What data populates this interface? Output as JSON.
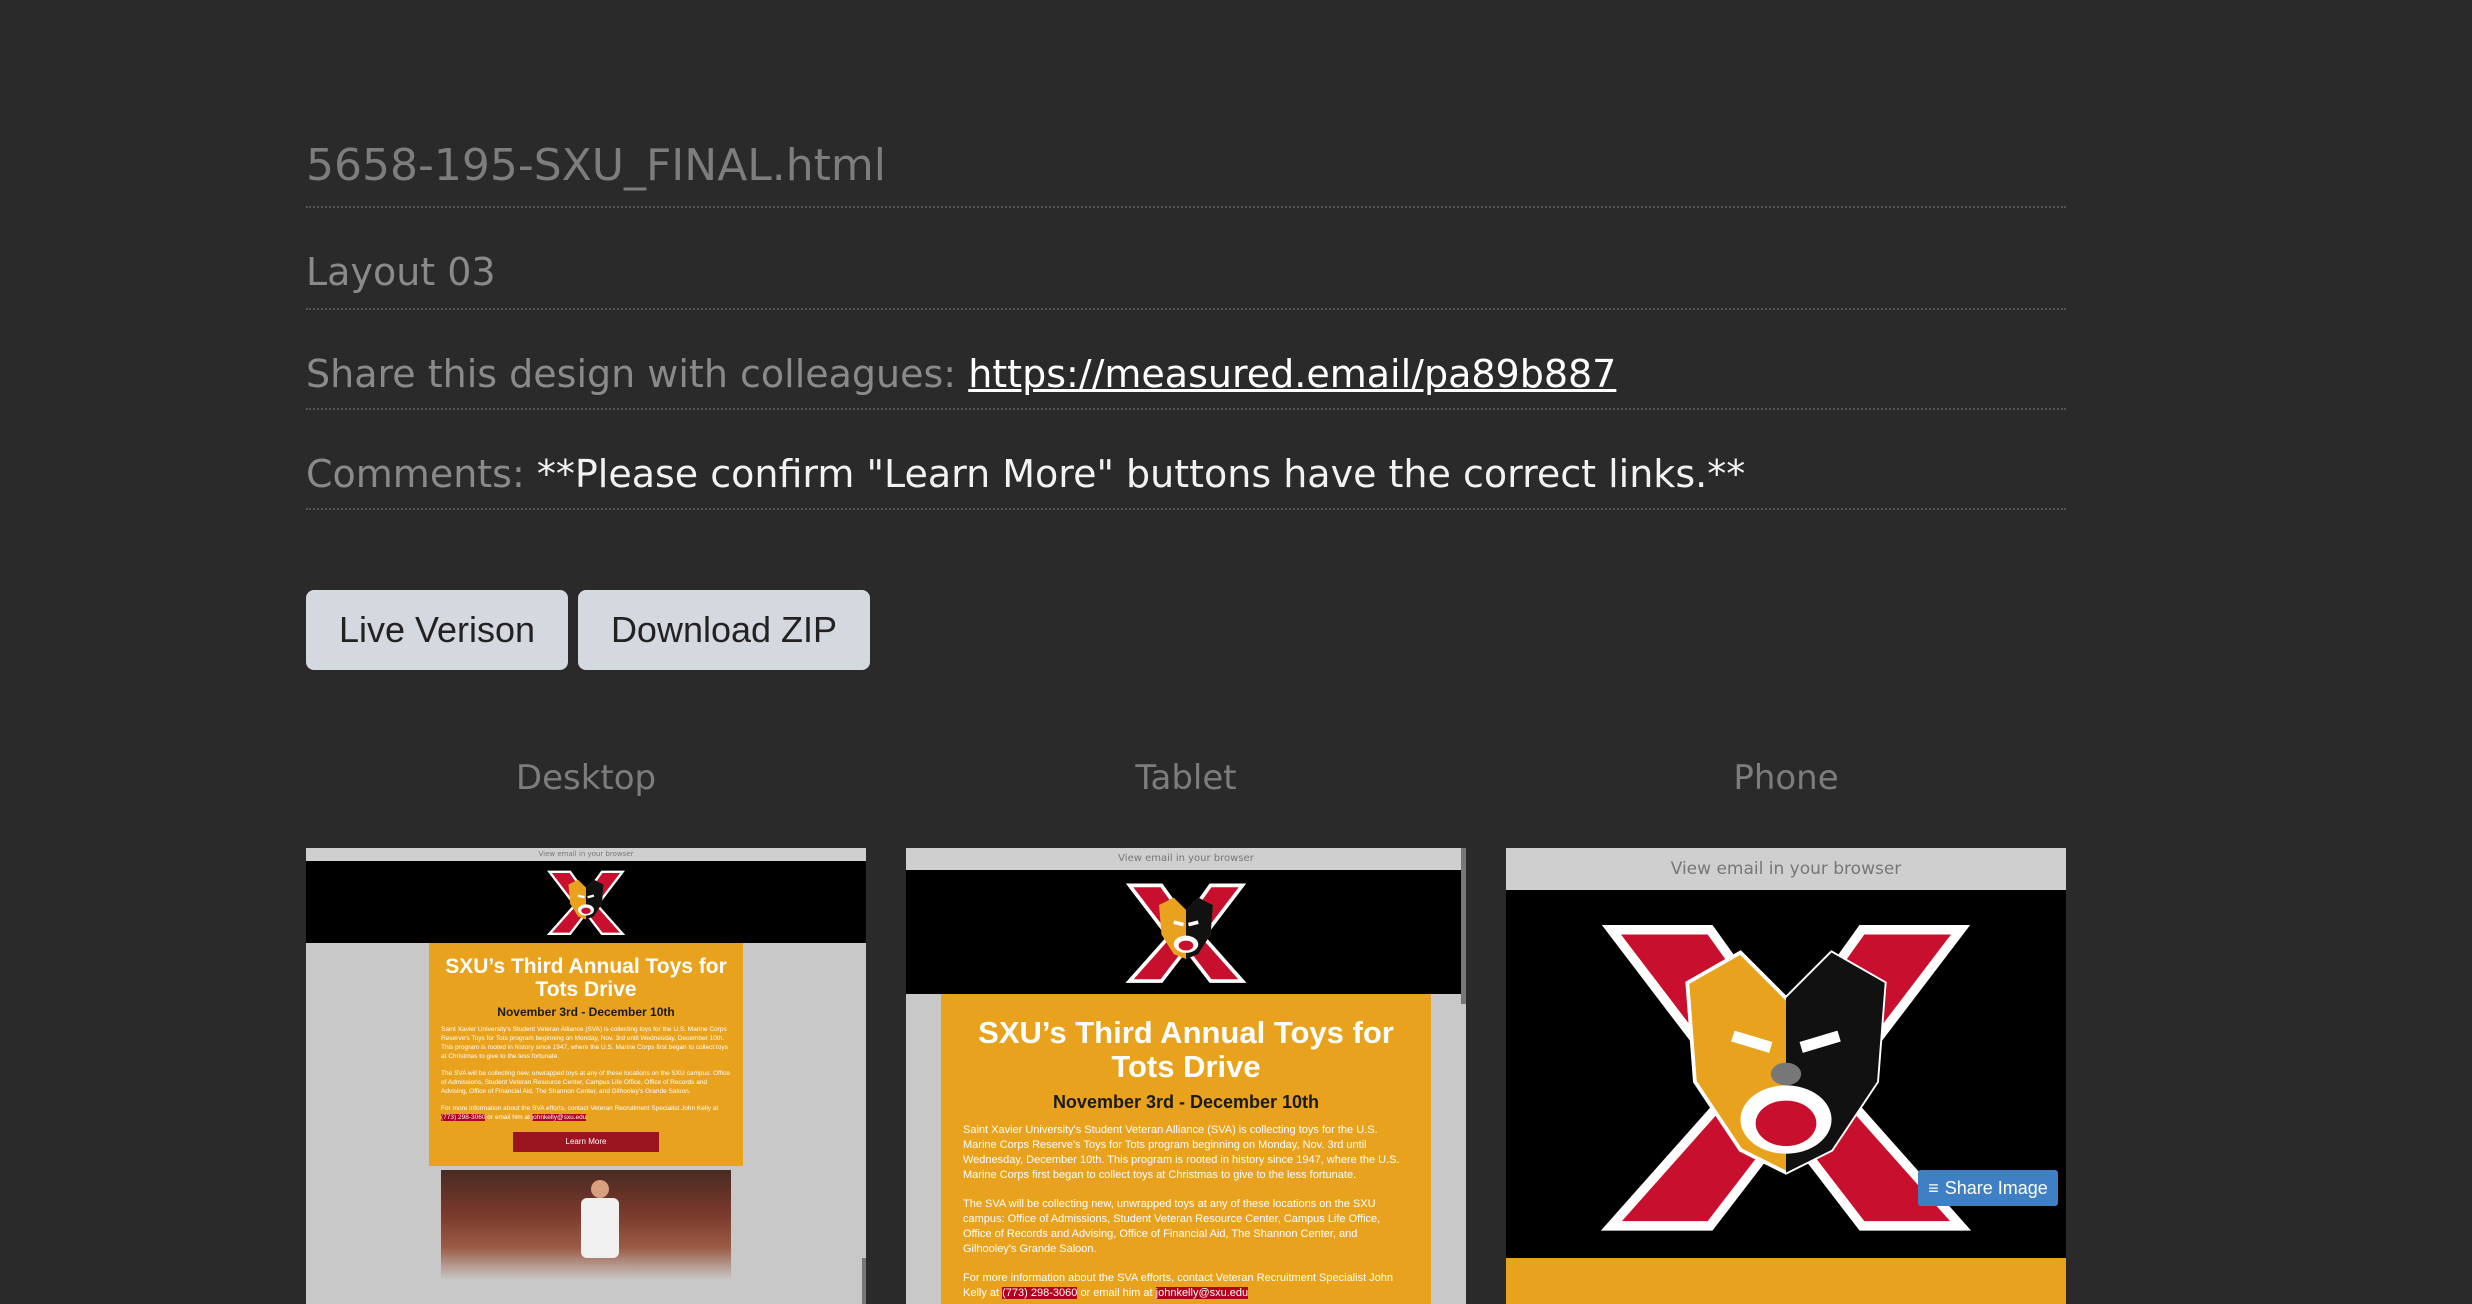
{
  "file": {
    "title": "5658-195-SXU_FINAL.html"
  },
  "layout": {
    "name": "Layout 03"
  },
  "share": {
    "label": "Share this design with colleagues:",
    "url": "https://measured.email/pa89b887"
  },
  "comments": {
    "label": "Comments:",
    "value": "**Please confirm \"Learn More\" buttons have the correct links.**"
  },
  "buttons": {
    "live": "Live Verison",
    "zip": "Download ZIP"
  },
  "previews": {
    "desktop_label": "Desktop",
    "tablet_label": "Tablet",
    "phone_label": "Phone"
  },
  "email": {
    "view_in_browser": "View email in your browser",
    "headline": "SXU’s Third Annual Toys for Tots Drive",
    "dates": "November 3rd - December 10th",
    "para1": "Saint Xavier University's Student Veteran Alliance (SVA) is collecting toys for the U.S. Marine Corps Reserve's Toys for Tots program beginning on Monday, Nov. 3rd until Wednesday, December 10th. This program is rooted in history since 1947, where the U.S. Marine Corps first began to collect toys at Christmas to give to the less fortunate.",
    "para2": "The SVA will be collecting new, unwrapped toys at any of these locations on the SXU campus: Office of Admissions, Student Veteran Resource Center, Campus Life Office, Office of Records and Advising, Office of Financial Aid, The Shannon Center, and Gilhooley's Grande Saloon.",
    "para3_prefix": "For more information about the SVA efforts, contact Veteran Recruitment Specialist John Kelly at",
    "phone": "(773) 298-3060",
    "para3_mid": "or email him at",
    "email": "johnkelly@sxu.edu",
    "learn_more": "Learn More",
    "share_image": "Share Image"
  },
  "colors": {
    "bg": "#2a2a2a",
    "gold": "#e8a21d",
    "crimson": "#9b1520",
    "button": "#d4d9df",
    "share_blue": "#3f7fc3"
  }
}
